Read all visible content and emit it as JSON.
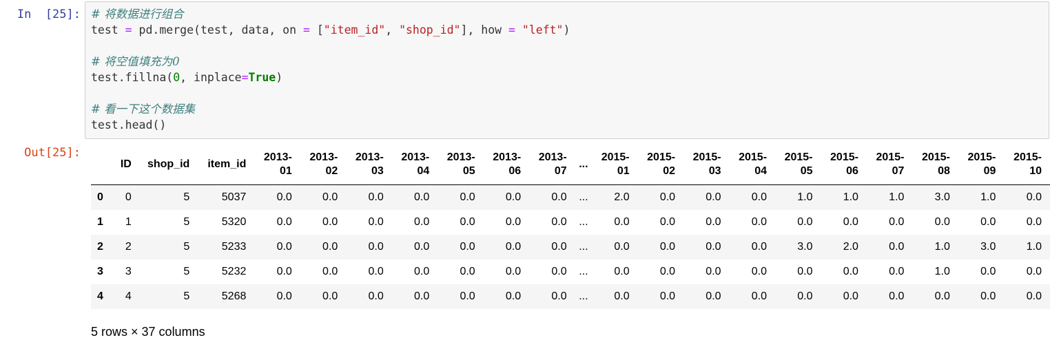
{
  "input_cell": {
    "prompt": "In  [25]:",
    "lines": [
      [
        {
          "t": "comment",
          "v": "# 将数据进行组合"
        }
      ],
      [
        {
          "t": "plain",
          "v": "test "
        },
        {
          "t": "op",
          "v": "="
        },
        {
          "t": "plain",
          "v": " pd.merge(test, data, on "
        },
        {
          "t": "op",
          "v": "="
        },
        {
          "t": "plain",
          "v": " ["
        },
        {
          "t": "str",
          "v": "\"item_id\""
        },
        {
          "t": "plain",
          "v": ", "
        },
        {
          "t": "str",
          "v": "\"shop_id\""
        },
        {
          "t": "plain",
          "v": "], how "
        },
        {
          "t": "op",
          "v": "="
        },
        {
          "t": "plain",
          "v": " "
        },
        {
          "t": "str",
          "v": "\"left\""
        },
        {
          "t": "plain",
          "v": ")"
        }
      ],
      [],
      [
        {
          "t": "comment",
          "v": "# 将空值填充为0"
        }
      ],
      [
        {
          "t": "plain",
          "v": "test.fillna("
        },
        {
          "t": "num",
          "v": "0"
        },
        {
          "t": "plain",
          "v": ", inplace"
        },
        {
          "t": "op",
          "v": "="
        },
        {
          "t": "kw",
          "v": "True"
        },
        {
          "t": "plain",
          "v": ")"
        }
      ],
      [],
      [
        {
          "t": "comment",
          "v": "# 看一下这个数据集"
        }
      ],
      [
        {
          "t": "plain",
          "v": "test.head()"
        }
      ]
    ]
  },
  "output_cell": {
    "prompt": "Out[25]:",
    "table": {
      "columns": [
        {
          "label": "ID",
          "cls": "c-id"
        },
        {
          "label": "shop_id",
          "cls": "c-shop"
        },
        {
          "label": "item_id",
          "cls": "c-item"
        },
        {
          "label": "2013-\n01",
          "cls": "c-month"
        },
        {
          "label": "2013-\n02",
          "cls": "c-month"
        },
        {
          "label": "2013-\n03",
          "cls": "c-month"
        },
        {
          "label": "2013-\n04",
          "cls": "c-month"
        },
        {
          "label": "2013-\n05",
          "cls": "c-month"
        },
        {
          "label": "2013-\n06",
          "cls": "c-month"
        },
        {
          "label": "2013-\n07",
          "cls": "c-month"
        },
        {
          "label": "...",
          "cls": "c-ell"
        },
        {
          "label": "2015-\n01",
          "cls": "c-month"
        },
        {
          "label": "2015-\n02",
          "cls": "c-month"
        },
        {
          "label": "2015-\n03",
          "cls": "c-month"
        },
        {
          "label": "2015-\n04",
          "cls": "c-month"
        },
        {
          "label": "2015-\n05",
          "cls": "c-month"
        },
        {
          "label": "2015-\n06",
          "cls": "c-month"
        },
        {
          "label": "2015-\n07",
          "cls": "c-month"
        },
        {
          "label": "2015-\n08",
          "cls": "c-month"
        },
        {
          "label": "2015-\n09",
          "cls": "c-month"
        },
        {
          "label": "2015-\n10",
          "cls": "c-month"
        }
      ],
      "rows": [
        {
          "index": "0",
          "cells": [
            "0",
            "5",
            "5037",
            "0.0",
            "0.0",
            "0.0",
            "0.0",
            "0.0",
            "0.0",
            "0.0",
            "...",
            "2.0",
            "0.0",
            "0.0",
            "0.0",
            "1.0",
            "1.0",
            "1.0",
            "3.0",
            "1.0",
            "0.0"
          ]
        },
        {
          "index": "1",
          "cells": [
            "1",
            "5",
            "5320",
            "0.0",
            "0.0",
            "0.0",
            "0.0",
            "0.0",
            "0.0",
            "0.0",
            "...",
            "0.0",
            "0.0",
            "0.0",
            "0.0",
            "0.0",
            "0.0",
            "0.0",
            "0.0",
            "0.0",
            "0.0"
          ]
        },
        {
          "index": "2",
          "cells": [
            "2",
            "5",
            "5233",
            "0.0",
            "0.0",
            "0.0",
            "0.0",
            "0.0",
            "0.0",
            "0.0",
            "...",
            "0.0",
            "0.0",
            "0.0",
            "0.0",
            "3.0",
            "2.0",
            "0.0",
            "1.0",
            "3.0",
            "1.0"
          ]
        },
        {
          "index": "3",
          "cells": [
            "3",
            "5",
            "5232",
            "0.0",
            "0.0",
            "0.0",
            "0.0",
            "0.0",
            "0.0",
            "0.0",
            "...",
            "0.0",
            "0.0",
            "0.0",
            "0.0",
            "0.0",
            "0.0",
            "0.0",
            "1.0",
            "0.0",
            "0.0"
          ]
        },
        {
          "index": "4",
          "cells": [
            "4",
            "5",
            "5268",
            "0.0",
            "0.0",
            "0.0",
            "0.0",
            "0.0",
            "0.0",
            "0.0",
            "...",
            "0.0",
            "0.0",
            "0.0",
            "0.0",
            "0.0",
            "0.0",
            "0.0",
            "0.0",
            "0.0",
            "0.0"
          ]
        }
      ]
    },
    "summary": "5 rows × 37 columns"
  }
}
